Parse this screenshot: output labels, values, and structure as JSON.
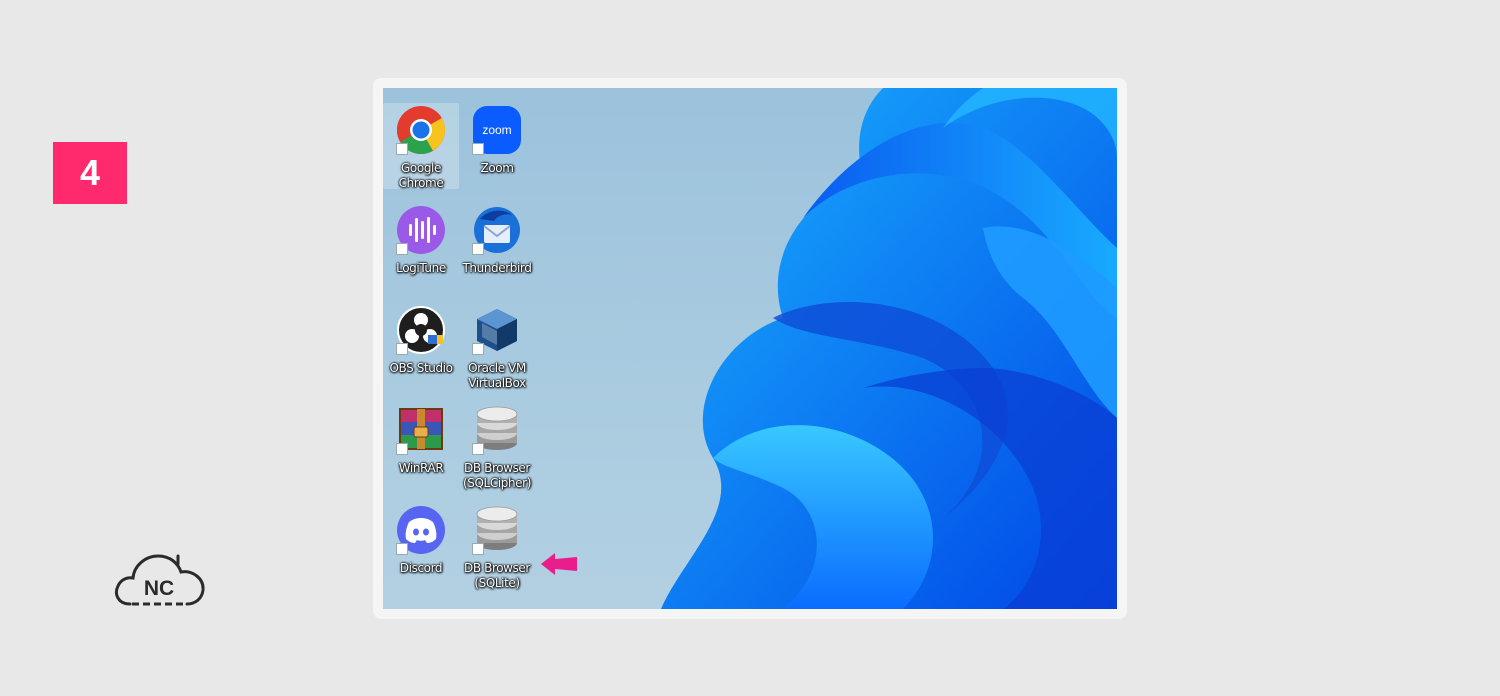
{
  "step": {
    "number": "4"
  },
  "logo": {
    "text": "NC"
  },
  "desktop": {
    "icons": [
      {
        "id": "google-chrome",
        "label": "Google\nChrome",
        "icon": "chrome-icon",
        "selected": true
      },
      {
        "id": "zoom",
        "label": "Zoom",
        "icon": "zoom-icon",
        "badge_text": "zoom"
      },
      {
        "id": "logitune",
        "label": "LogiTune",
        "icon": "logitune-icon"
      },
      {
        "id": "thunderbird",
        "label": "Thunderbird",
        "icon": "thunderbird-icon"
      },
      {
        "id": "obs-studio",
        "label": "OBS Studio",
        "icon": "obs-icon"
      },
      {
        "id": "virtualbox",
        "label": "Oracle VM\nVirtualBox",
        "icon": "virtualbox-icon"
      },
      {
        "id": "winrar",
        "label": "WinRAR",
        "icon": "winrar-icon"
      },
      {
        "id": "db-browser-sqlcipher",
        "label": "DB Browser\n(SQLCipher)",
        "icon": "database-icon"
      },
      {
        "id": "discord",
        "label": "Discord",
        "icon": "discord-icon"
      },
      {
        "id": "db-browser-sqlite",
        "label": "DB Browser\n(SQLite)",
        "icon": "database-icon",
        "highlighted": true
      }
    ]
  },
  "colors": {
    "badge": "#ff2a6d",
    "pointer": "#e91e8c",
    "wallpaper_blue": "#0a6cff"
  }
}
